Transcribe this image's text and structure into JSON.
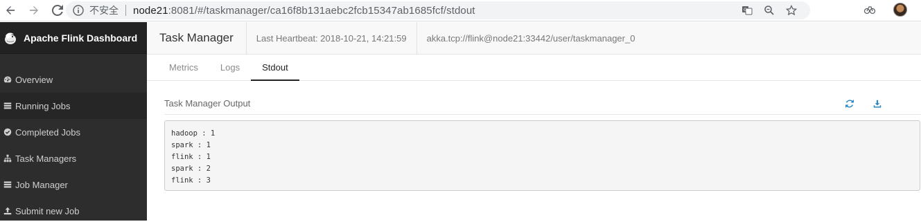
{
  "browser": {
    "insecure_label": "不安全",
    "url_host": "node21",
    "url_path": ":8081/#/taskmanager/ca16f8b131aebc2fcb15347ab1685fcf/stdout"
  },
  "sidebar": {
    "brand": "Apache Flink Dashboard",
    "items": [
      {
        "label": "Overview",
        "icon": "dashboard-icon"
      },
      {
        "label": "Running Jobs",
        "icon": "tasks-icon"
      },
      {
        "label": "Completed Jobs",
        "icon": "check-circle-icon"
      },
      {
        "label": "Task Managers",
        "icon": "sitemap-icon"
      },
      {
        "label": "Job Manager",
        "icon": "list-icon"
      },
      {
        "label": "Submit new Job",
        "icon": "upload-icon"
      }
    ]
  },
  "header": {
    "title": "Task Manager",
    "heartbeat": "Last Heartbeat: 2018-10-21, 14:21:59",
    "address": "akka.tcp://flink@node21:33442/user/taskmanager_0"
  },
  "tabs": [
    {
      "label": "Metrics"
    },
    {
      "label": "Logs"
    },
    {
      "label": "Stdout"
    }
  ],
  "panel": {
    "title": "Task Manager Output",
    "lines": [
      "hadoop : 1",
      "spark : 1",
      "flink : 1",
      "spark : 2",
      "flink : 3"
    ]
  },
  "colors": {
    "sidebar_bg": "#2d2d2d",
    "accent": "#2a8ac6"
  }
}
